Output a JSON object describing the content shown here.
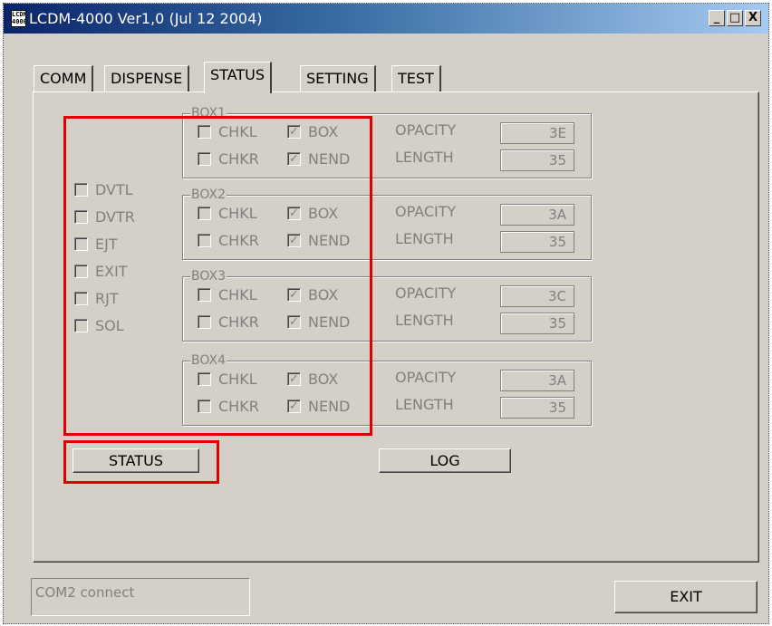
{
  "window": {
    "icon_text": "LCDM 4000",
    "title": "LCDM-4000 Ver1,0 (Jul 12 2004)",
    "min_glyph": "_",
    "max_glyph": "□",
    "close_glyph": "X"
  },
  "tabs": [
    "COMM",
    "DISPENSE",
    "STATUS",
    "SETTING",
    "TEST"
  ],
  "active_tab": "STATUS",
  "sensors": [
    {
      "label": "DVTL",
      "checked": false
    },
    {
      "label": "DVTR",
      "checked": false
    },
    {
      "label": "EJT",
      "checked": false
    },
    {
      "label": "EXIT",
      "checked": false
    },
    {
      "label": "RJT",
      "checked": false
    },
    {
      "label": "SOL",
      "checked": false
    }
  ],
  "boxes": [
    {
      "name": "BOX1",
      "chkl": "CHKL",
      "chkr": "CHKR",
      "box": "BOX",
      "nend": "NEND",
      "opacity_label": "OPACITY",
      "length_label": "LENGTH",
      "opacity": "3E",
      "length": "35"
    },
    {
      "name": "BOX2",
      "chkl": "CHKL",
      "chkr": "CHKR",
      "box": "BOX",
      "nend": "NEND",
      "opacity_label": "OPACITY",
      "length_label": "LENGTH",
      "opacity": "3A",
      "length": "35"
    },
    {
      "name": "BOX3",
      "chkl": "CHKL",
      "chkr": "CHKR",
      "box": "BOX",
      "nend": "NEND",
      "opacity_label": "OPACITY",
      "length_label": "LENGTH",
      "opacity": "3C",
      "length": "35"
    },
    {
      "name": "BOX4",
      "chkl": "CHKL",
      "chkr": "CHKR",
      "box": "BOX",
      "nend": "NEND",
      "opacity_label": "OPACITY",
      "length_label": "LENGTH",
      "opacity": "3A",
      "length": "35"
    }
  ],
  "check_glyph": "✓",
  "buttons": {
    "status": "STATUS",
    "log": "LOG",
    "exit": "EXIT"
  },
  "status_text": "COM2 connect",
  "colors": {
    "highlight": "#e00000",
    "face": "#d4d0c8",
    "title_start": "#0a246a"
  }
}
